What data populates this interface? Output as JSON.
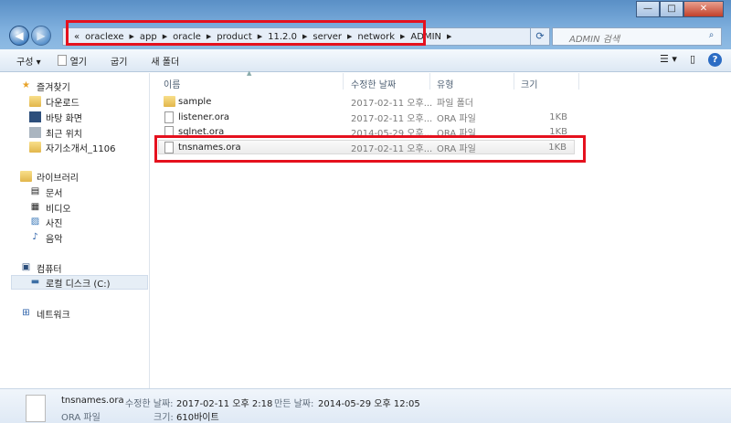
{
  "window": {
    "minimize": "—",
    "maximize": "□",
    "close": "✕"
  },
  "nav": {
    "back": "◀",
    "forward": "▶"
  },
  "address": {
    "overflow": "«",
    "crumbs": [
      "oraclexe",
      "app",
      "oracle",
      "product",
      "11.2.0",
      "server",
      "network",
      "ADMIN"
    ]
  },
  "search": {
    "placeholder": "ADMIN 검색"
  },
  "toolbar": {
    "organize": "구성 ▾",
    "open": "열기",
    "share": "굽기",
    "new_folder": "새 폴더"
  },
  "sidebar": {
    "favorites": {
      "label": "즐겨찾기",
      "items": [
        "다운로드",
        "바탕 화면",
        "최근 위치",
        "자기소개서_1106"
      ]
    },
    "libraries": {
      "label": "라이브러리",
      "items": [
        "문서",
        "비디오",
        "사진",
        "음악"
      ]
    },
    "computer": {
      "label": "컴퓨터",
      "items": [
        "로컬 디스크 (C:)"
      ]
    },
    "network": {
      "label": "네트워크"
    }
  },
  "columns": {
    "name": "이름",
    "modified": "수정한 날짜",
    "type": "유형",
    "size": "크기"
  },
  "files": [
    {
      "name": "sample",
      "modified": "2017-02-11 오후...",
      "type": "파일 폴더",
      "size": ""
    },
    {
      "name": "listener.ora",
      "modified": "2017-02-11 오후...",
      "type": "ORA 파일",
      "size": "1KB"
    },
    {
      "name": "sqlnet.ora",
      "modified": "2014-05-29 오후...",
      "type": "ORA 파일",
      "size": "1KB"
    },
    {
      "name": "tnsnames.ora",
      "modified": "2017-02-11 오후...",
      "type": "ORA 파일",
      "size": "1KB"
    }
  ],
  "details": {
    "name": "tnsnames.ora",
    "type": "ORA 파일",
    "modified_label": "수정한 날짜:",
    "modified": "2017-02-11 오후 2:18",
    "created_label": "만든 날짜:",
    "created": "2014-05-29 오후 12:05",
    "size_label": "크기:",
    "size": "610바이트"
  }
}
